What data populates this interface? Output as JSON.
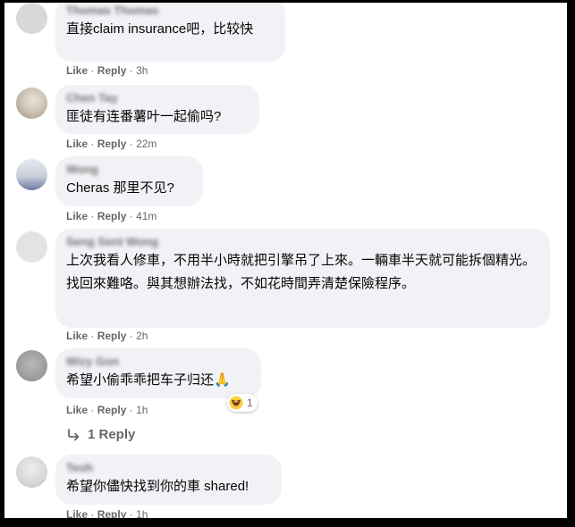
{
  "comments": [
    {
      "author": "Thomas Thomas",
      "lines": [
        "直接claim insurance吧，比较快"
      ],
      "like": "Like",
      "reply": "Reply",
      "time": "3h"
    },
    {
      "author": "Chen Tay",
      "lines": [
        "匪徒有连番薯叶一起偷吗?"
      ],
      "like": "Like",
      "reply": "Reply",
      "time": "22m"
    },
    {
      "author": "Wong",
      "lines": [
        "Cheras 那里不见?"
      ],
      "like": "Like",
      "reply": "Reply",
      "time": "41m"
    },
    {
      "author": "Seng Sent Wong",
      "lines": [
        "上次我看人修車，不用半小時就把引擎吊了上來。一輛車半天就可能拆個精光。",
        "找回來難咯。與其想辦法找，不如花時間弄清楚保險程序。"
      ],
      "like": "Like",
      "reply": "Reply",
      "time": "2h"
    },
    {
      "author": "Wizy Gon",
      "lines": [
        "希望小偷乖乖把车子归还🙏"
      ],
      "like": "Like",
      "reply": "Reply",
      "time": "1h",
      "reaction_count": "1",
      "reaction_icon": "haha-emoji-icon"
    },
    {
      "author": "Teoh",
      "lines": [
        "希望你儘快找到你的車 shared!"
      ],
      "like": "Like",
      "reply": "Reply",
      "time": "1h"
    }
  ],
  "replies_link": {
    "label": "1 Reply"
  },
  "colors": {
    "bubble": "#f0f2f5",
    "meta": "#65676b",
    "text": "#050505",
    "frame": "#000000"
  }
}
